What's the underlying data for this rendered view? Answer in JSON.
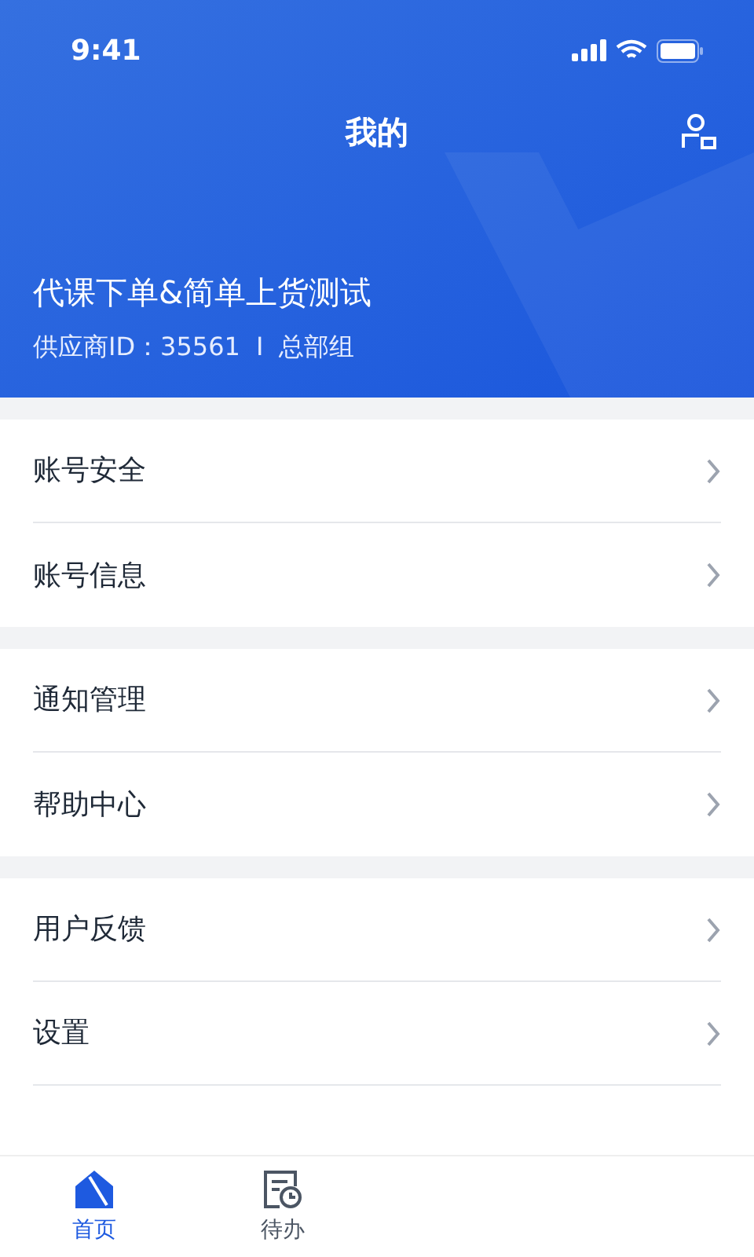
{
  "status_bar": {
    "time": "9:41"
  },
  "header": {
    "title": "我的"
  },
  "profile": {
    "name": "代课下单&简单上货测试",
    "supplier_label": "供应商ID：",
    "supplier_id": "35561",
    "separator": "I",
    "group": "总部组"
  },
  "menu_groups": [
    [
      {
        "label": "账号安全"
      },
      {
        "label": "账号信息"
      }
    ],
    [
      {
        "label": "通知管理"
      },
      {
        "label": "帮助中心"
      }
    ],
    [
      {
        "label": "用户反馈"
      },
      {
        "label": "设置"
      }
    ]
  ],
  "tab_bar": [
    {
      "label": "首页",
      "kind": "home",
      "selected": true
    },
    {
      "label": "待办",
      "kind": "todo",
      "selected": false
    }
  ]
}
